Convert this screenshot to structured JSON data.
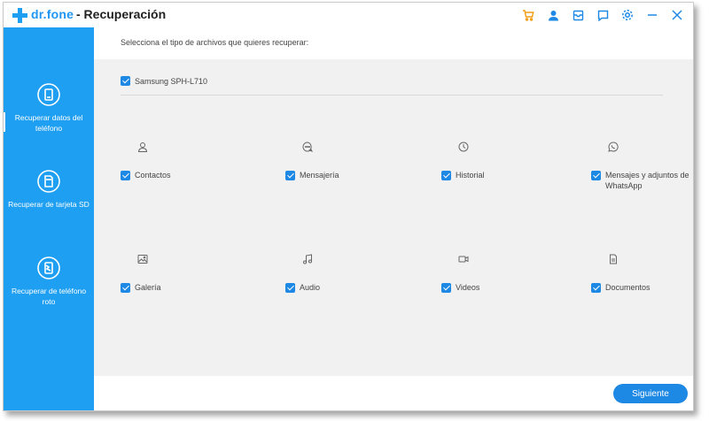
{
  "app": {
    "brand": "dr.fone",
    "title": "- Recuperación",
    "accent_color": "#1e9ff2",
    "cart_color": "#f39c12"
  },
  "titlebar_icons": [
    "cart-icon",
    "user-icon",
    "inbox-icon",
    "chat-icon",
    "gear-icon",
    "minimize-icon",
    "close-icon"
  ],
  "sidebar": {
    "items": [
      {
        "label": "Recuperar datos del teléfono",
        "icon": "phone-recover-icon",
        "active": true
      },
      {
        "label": "Recuperar de tarjeta SD",
        "icon": "sd-recover-icon",
        "active": false
      },
      {
        "label": "Recuperar de teléfono roto",
        "icon": "broken-phone-icon",
        "active": false
      }
    ]
  },
  "main": {
    "prompt": "Selecciona el tipo de archivos que quieres recuperar:",
    "device": {
      "name": "Samsung SPH-L710",
      "checked": true
    },
    "categories": [
      {
        "label": "Contactos",
        "icon": "contact-icon",
        "checked": true
      },
      {
        "label": "Mensajería",
        "icon": "message-icon",
        "checked": true
      },
      {
        "label": "Historial",
        "icon": "clock-icon",
        "checked": true
      },
      {
        "label": "Mensajes y adjuntos de WhatsApp",
        "icon": "whatsapp-icon",
        "checked": true
      },
      {
        "label": "Galería",
        "icon": "image-icon",
        "checked": true
      },
      {
        "label": "Audio",
        "icon": "music-icon",
        "checked": true
      },
      {
        "label": "Videos",
        "icon": "video-icon",
        "checked": true
      },
      {
        "label": "Documentos",
        "icon": "document-icon",
        "checked": true
      }
    ],
    "next_button": "Siguiente"
  }
}
